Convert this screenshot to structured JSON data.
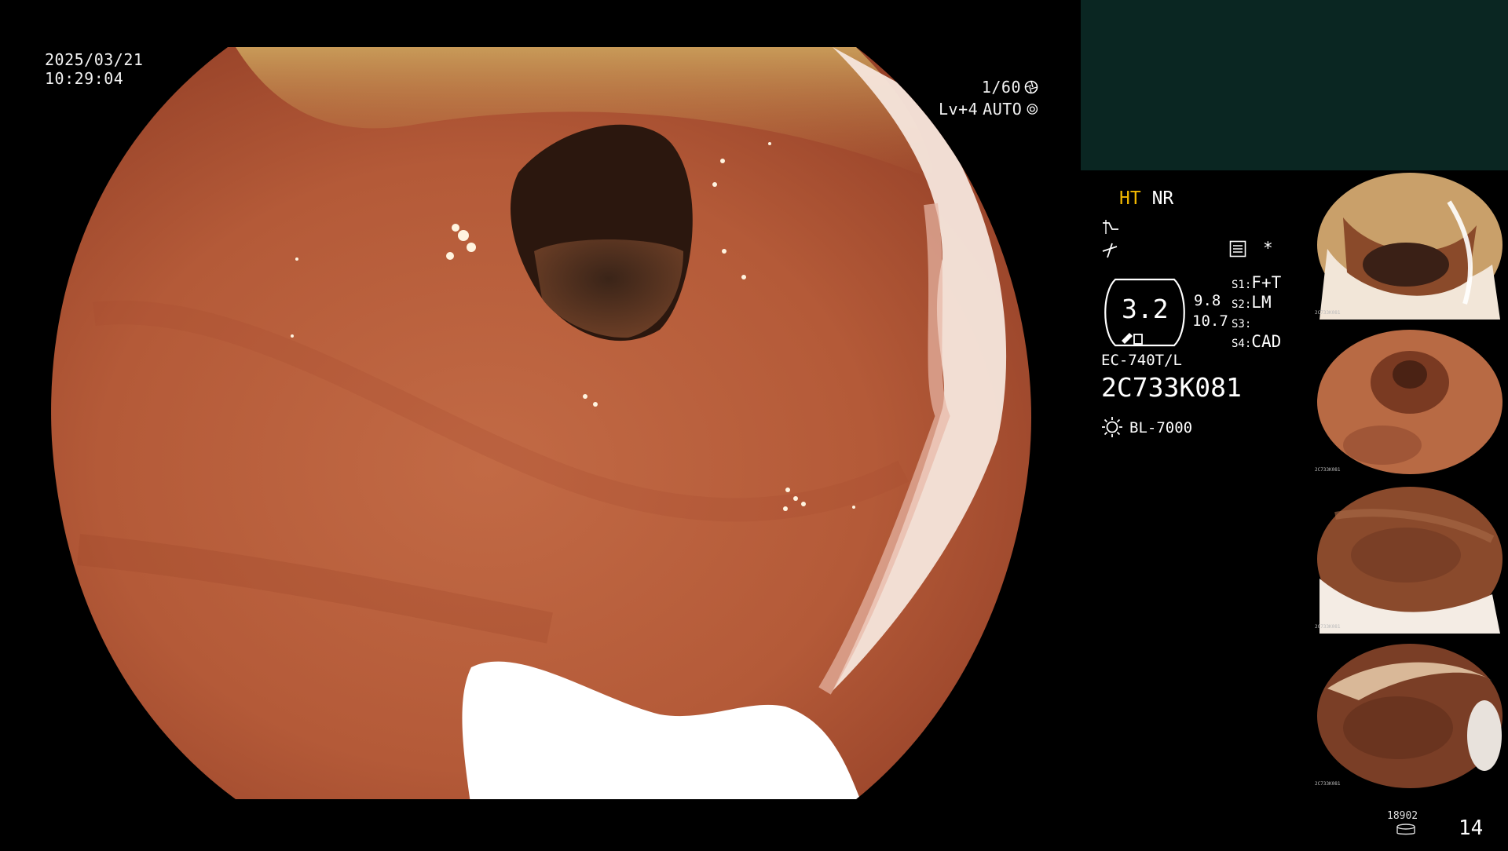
{
  "overlay": {
    "date": "2025/03/21",
    "time": "10:29:04",
    "shutter": "1/60",
    "level": "Lv+4",
    "exposure_mode": "AUTO"
  },
  "settings": {
    "mode_ht": "HT",
    "mode_nr": "NR",
    "zoom_value": "3.2",
    "side_value_1": "9.8",
    "side_value_2": "10.7",
    "s1_label": "S1:",
    "s1_value": "F+T",
    "s2_label": "S2:",
    "s2_value": "LM",
    "s3_label": "S3:",
    "s3_value": "",
    "s4_label": "S4:",
    "s4_value": "CAD",
    "asterisk": "*",
    "scope_model": "EC-740T/L",
    "scope_serial": "2C733K081",
    "light_source": "BL-7000"
  },
  "footer": {
    "capture_counter": "18902",
    "image_count": "14"
  },
  "thumbnails": [
    {
      "name": "thumbnail-1",
      "label": "2C733K081"
    },
    {
      "name": "thumbnail-2",
      "label": "2C733K081"
    },
    {
      "name": "thumbnail-3",
      "label": "2C733K081"
    },
    {
      "name": "thumbnail-4",
      "label": "2C733K081"
    }
  ],
  "icons": {
    "shutter": "aperture-icon",
    "auto": "iris-icon",
    "curve1": "tone-curve-icon",
    "curve2": "structure-enhance-icon",
    "menu": "menu-icon",
    "light": "light-bulb-icon",
    "zoom_badge": "zoom-badge-icon",
    "storage": "storage-icon"
  },
  "colors": {
    "ht_accent": "#f2b800",
    "panel_teal": "#0a2622"
  }
}
